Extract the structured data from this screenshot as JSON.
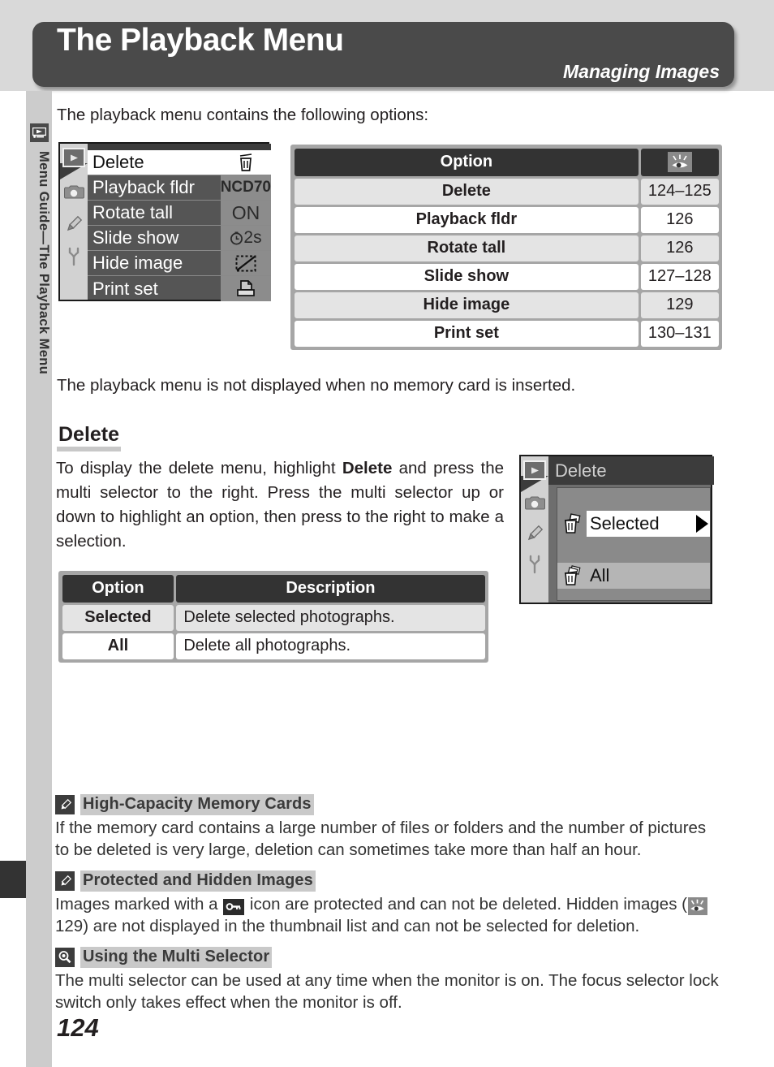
{
  "header": {
    "title": "The Playback Menu",
    "subtitle": "Managing Images"
  },
  "sidebar": {
    "icon": "playback-icon",
    "label": "Menu Guide—The Playback Menu"
  },
  "intro_text": "The playback menu contains the following options:",
  "lcd_playback": {
    "rail_icons": [
      "playback-icon",
      "camera-icon",
      "pencil-icon",
      "wrench-icon"
    ],
    "rows": [
      {
        "label": "Delete",
        "value": "trash-icon",
        "value_kind": "icon",
        "selected": true
      },
      {
        "label": "Playback fldr",
        "value": "NCD70",
        "value_kind": "text",
        "selected": false
      },
      {
        "label": "Rotate tall",
        "value": "ON",
        "value_kind": "text",
        "selected": false
      },
      {
        "label": "Slide show",
        "value": "2s",
        "value_kind": "clock",
        "selected": false
      },
      {
        "label": "Hide image",
        "value": "hide-image-icon",
        "value_kind": "icon",
        "selected": false
      },
      {
        "label": "Print set",
        "value": "print-set-icon",
        "value_kind": "icon",
        "selected": false
      }
    ]
  },
  "options_table": {
    "headers": {
      "option": "Option",
      "page_icon": "eye-reference-icon"
    },
    "rows": [
      {
        "option": "Delete",
        "page": "124–125"
      },
      {
        "option": "Playback fldr",
        "page": "126"
      },
      {
        "option": "Rotate tall",
        "page": "126"
      },
      {
        "option": "Slide show",
        "page": "127–128"
      },
      {
        "option": "Hide image",
        "page": "129"
      },
      {
        "option": "Print set",
        "page": "130–131"
      }
    ]
  },
  "no_card_text": "The playback menu is not displayed when no memory card is inserted.",
  "delete_section": {
    "heading": "Delete",
    "paragraph_1": "To display the delete menu, highlight ",
    "paragraph_bold": "Delete",
    "paragraph_2": " and press the multi selector to the right.  Press the multi selector up or down to highlight an option, then press to the right to make a selection."
  },
  "lcd_delete": {
    "title": "Delete",
    "rail_icons": [
      "playback-icon",
      "camera-icon",
      "pencil-icon",
      "wrench-icon"
    ],
    "rows": [
      {
        "label": "Selected",
        "icon": "delete-selected-icon",
        "selected": true
      },
      {
        "label": "All",
        "icon": "delete-all-icon",
        "selected": false
      }
    ]
  },
  "desc_table": {
    "headers": {
      "option": "Option",
      "description": "Description"
    },
    "rows": [
      {
        "option": "Selected",
        "description": "Delete selected photographs."
      },
      {
        "option": "All",
        "description": "Delete all photographs."
      }
    ]
  },
  "notes": [
    {
      "icon": "pencil-note-icon",
      "title": "High-Capacity Memory Cards",
      "body": "If the memory card contains a large number of files or folders and the number of pictures to be deleted is very large, deletion can sometimes take more than half an hour."
    },
    {
      "icon": "pencil-note-icon",
      "title": "Protected and Hidden Images",
      "body_part_1": "Images marked with a ",
      "inline_icon_1": "protect-key-icon",
      "body_part_2": " icon are protected and can not be deleted.  Hidden images (",
      "inline_icon_2": "eye-reference-icon",
      "body_part_3": " 129) are not displayed in the thumbnail list and can not be selected for deletion."
    },
    {
      "icon": "magnifier-note-icon",
      "title": "Using the Multi Selector",
      "body": "The multi selector can be used at any time when the monitor is on.  The focus selector lock switch only takes effect when the monitor is off."
    }
  ],
  "page_number": "124"
}
